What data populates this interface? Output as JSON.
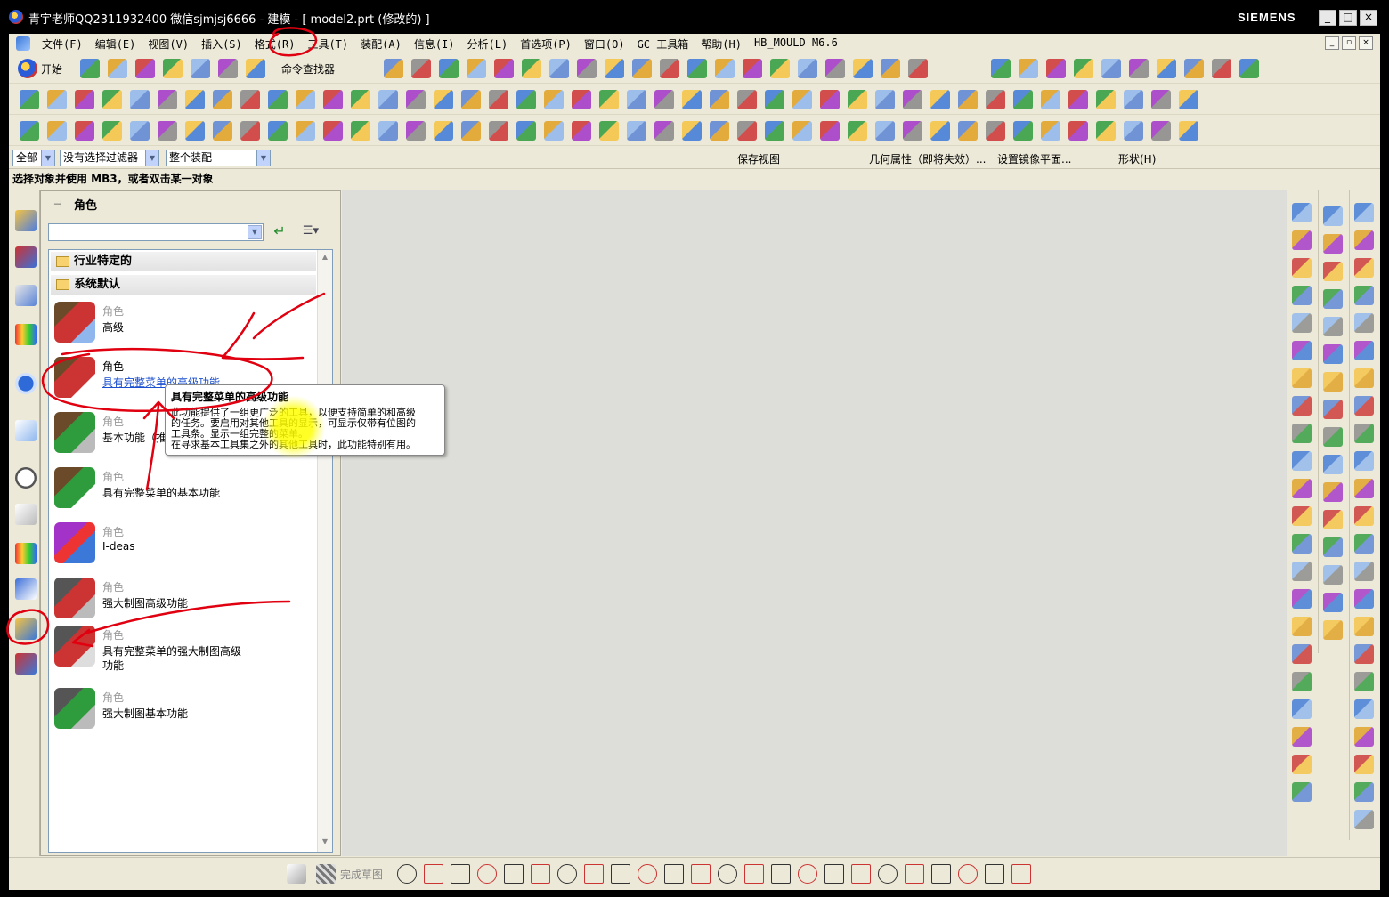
{
  "window": {
    "title": "青宇老师QQ2311932400 微信sjmjsj6666 - 建模 - [ model2.prt  (修改的) ]",
    "brand": "SIEMENS",
    "min": "_",
    "max": "□",
    "close": "×"
  },
  "menu": [
    "文件(F)",
    "编辑(E)",
    "视图(V)",
    "插入(S)",
    "格式(R)",
    "工具(T)",
    "装配(A)",
    "信息(I)",
    "分析(L)",
    "首选项(P)",
    "窗口(O)",
    "GC 工具箱",
    "帮助(H)",
    "HB_MOULD M6.6"
  ],
  "toolbar": {
    "start_label": "开始",
    "cmd_finder": "命令查找器"
  },
  "selection_bar": {
    "filter_scope": "全部",
    "type_filter": "没有选择过滤器",
    "assembly_scope": "整个装配",
    "save_view": "保存视图",
    "geom_props": "几何属性（即将失效）...",
    "mirror_plane": "设置镜像平面...",
    "shape": "形状(H)"
  },
  "status": "选择对象并使用 MB3，或者双击某一对象",
  "role_panel": {
    "title": "角色",
    "categories": [
      "行业特定的",
      "系统默认"
    ],
    "role_kind": "角色",
    "roles": [
      {
        "name": "高级",
        "name2": ""
      },
      {
        "name": "具有完整菜单的高级功能",
        "name2": ""
      },
      {
        "name": "基本功能（推荐）",
        "name2": ""
      },
      {
        "name": "具有完整菜单的基本功能",
        "name2": ""
      },
      {
        "name": "I-deas",
        "name2": ""
      },
      {
        "name": "强大制图高级功能",
        "name2": ""
      },
      {
        "name": "具有完整菜单的强大制图高级",
        "name2": "功能"
      },
      {
        "name": "强大制图基本功能",
        "name2": ""
      }
    ]
  },
  "tooltip": {
    "title": "具有完整菜单的高级功能",
    "line1": "此功能提供了一组更广泛的工具，以便支持简单的和高级",
    "line2": "的任务。要启用对其他工具的显示，可显示仅带有位图的",
    "line3": "工具条。显示一组完整的菜单。",
    "line4": "在寻求基本工具集之外的其他工具时，此功能特别有用。"
  },
  "bottom_toolbar": {
    "finish_sketch": "完成草图"
  },
  "colors": {
    "frame": "#ece9d8",
    "graphics": "#ddddd9",
    "annotation": "#e00010",
    "link": "#1a4fd0"
  }
}
